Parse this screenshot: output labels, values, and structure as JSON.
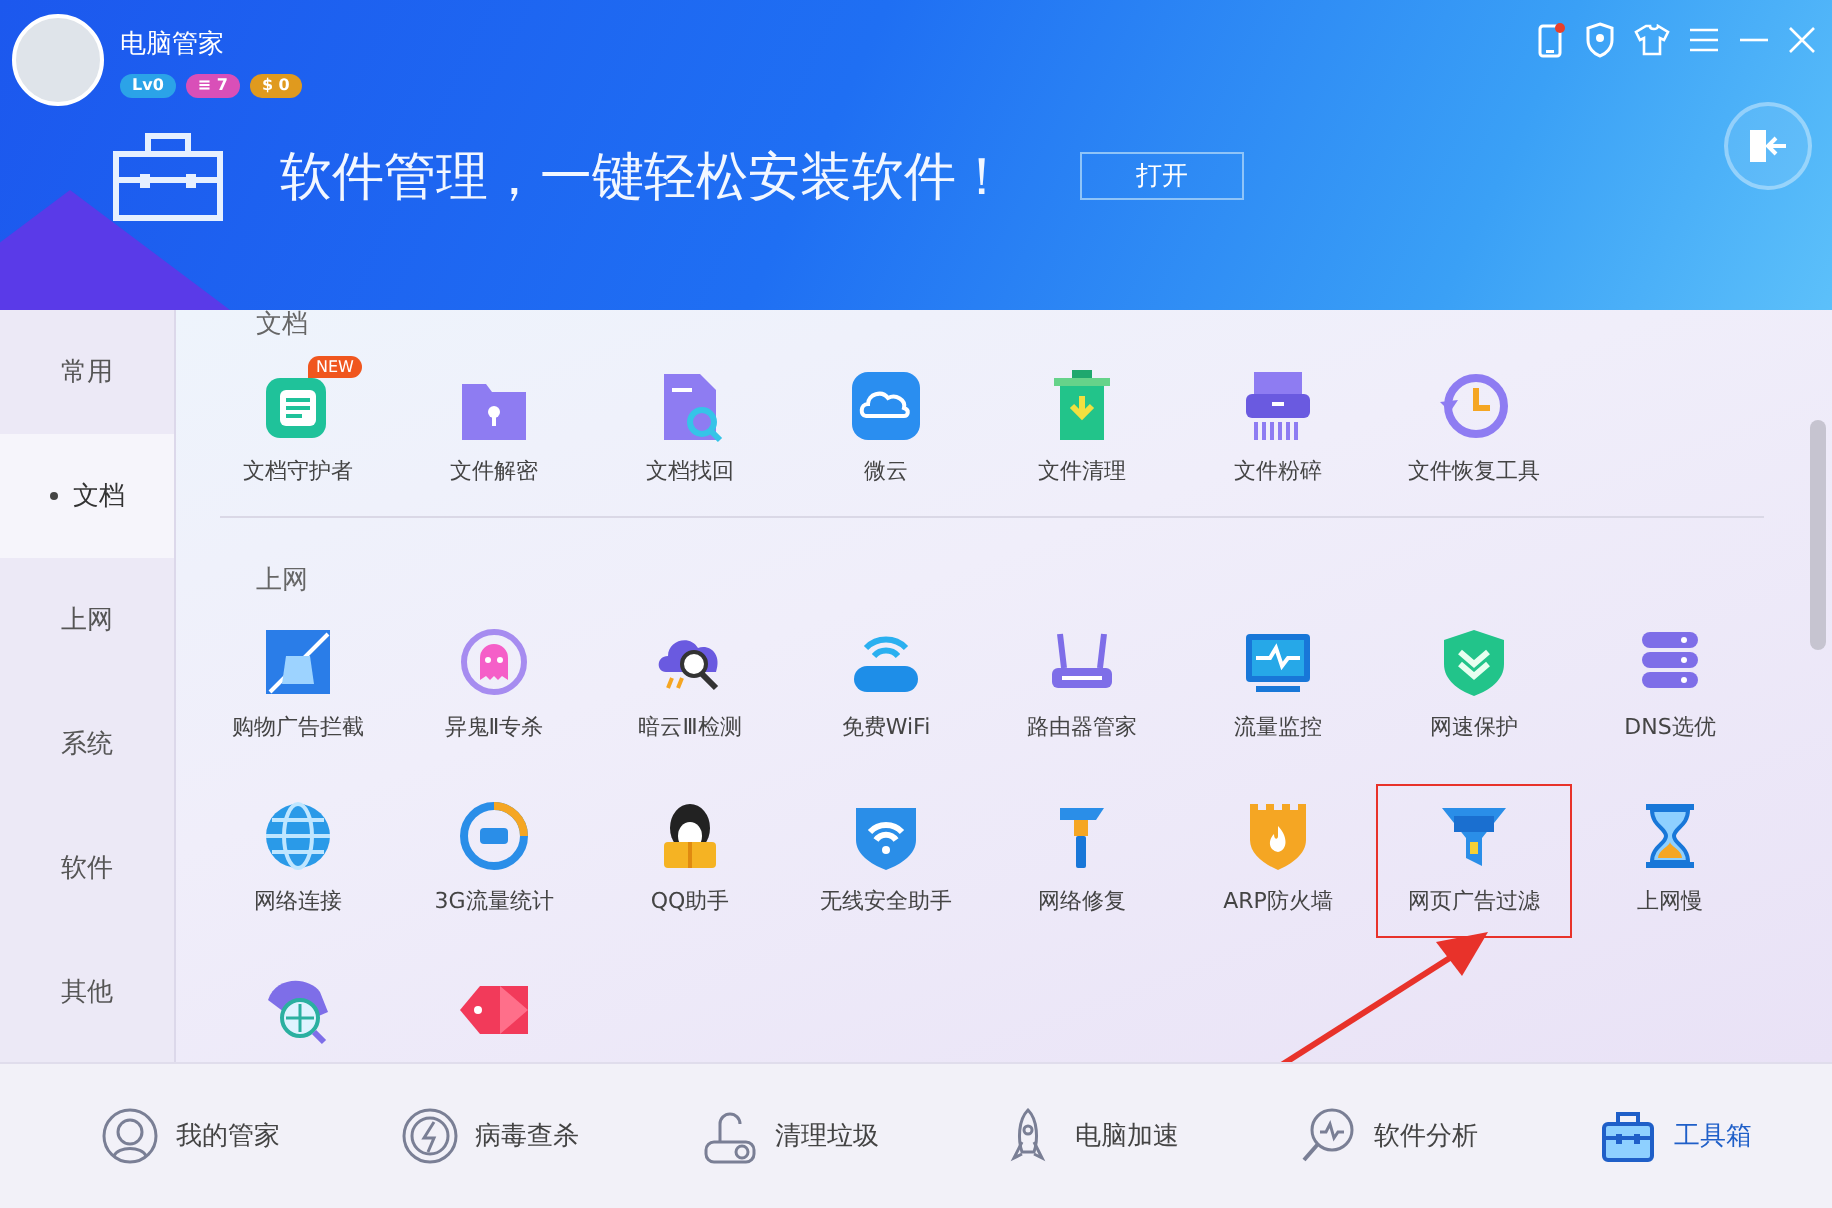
{
  "app": {
    "name": "电脑管家",
    "badges": [
      {
        "label": "Lv0",
        "color": "#2ba3e8"
      },
      {
        "label": "≡ 7",
        "color": "#d94fb8"
      },
      {
        "label": "$ 0",
        "color": "#e09a1e"
      }
    ],
    "phone_notice": true
  },
  "banner": {
    "title": "软件管理，一键轻松安装软件！",
    "button": "打开"
  },
  "sidebar": {
    "items": [
      {
        "label": "常用",
        "selected": false
      },
      {
        "label": "文档",
        "selected": true
      },
      {
        "label": "上网",
        "selected": false
      },
      {
        "label": "系统",
        "selected": false
      },
      {
        "label": "软件",
        "selected": false
      },
      {
        "label": "其他",
        "selected": false
      }
    ]
  },
  "sections": [
    {
      "title": "文档",
      "items": [
        {
          "label": "文档守护者",
          "badge": "NEW",
          "highlighted": false
        },
        {
          "label": "文件解密",
          "highlighted": false
        },
        {
          "label": "文档找回",
          "highlighted": false
        },
        {
          "label": "微云",
          "highlighted": false
        },
        {
          "label": "文件清理",
          "highlighted": false
        },
        {
          "label": "文件粉碎",
          "highlighted": false
        },
        {
          "label": "文件恢复工具",
          "highlighted": false
        }
      ]
    },
    {
      "title": "上网",
      "items": [
        {
          "label": "购物广告拦截",
          "highlighted": false
        },
        {
          "label": "异鬼Ⅱ专杀",
          "highlighted": false
        },
        {
          "label": "暗云Ⅲ检测",
          "highlighted": false
        },
        {
          "label": "免费WiFi",
          "highlighted": false
        },
        {
          "label": "路由器管家",
          "highlighted": false
        },
        {
          "label": "流量监控",
          "highlighted": false
        },
        {
          "label": "网速保护",
          "highlighted": false
        },
        {
          "label": "DNS选优",
          "highlighted": false
        },
        {
          "label": "网络连接",
          "highlighted": false
        },
        {
          "label": "3G流量统计",
          "highlighted": false
        },
        {
          "label": "QQ助手",
          "highlighted": false
        },
        {
          "label": "无线安全助手",
          "highlighted": false
        },
        {
          "label": "网络修复",
          "highlighted": false
        },
        {
          "label": "ARP防火墙",
          "highlighted": false
        },
        {
          "label": "网页广告过滤",
          "highlighted": true
        },
        {
          "label": "上网慢",
          "highlighted": false
        },
        {
          "highlighted": false
        },
        {
          "highlighted": false
        }
      ]
    }
  ],
  "bottom_nav": [
    {
      "label": "我的管家",
      "selected": false
    },
    {
      "label": "病毒查杀",
      "selected": false
    },
    {
      "label": "清理垃圾",
      "selected": false
    },
    {
      "label": "电脑加速",
      "selected": false
    },
    {
      "label": "软件分析",
      "selected": false
    },
    {
      "label": "工具箱",
      "selected": true
    }
  ]
}
